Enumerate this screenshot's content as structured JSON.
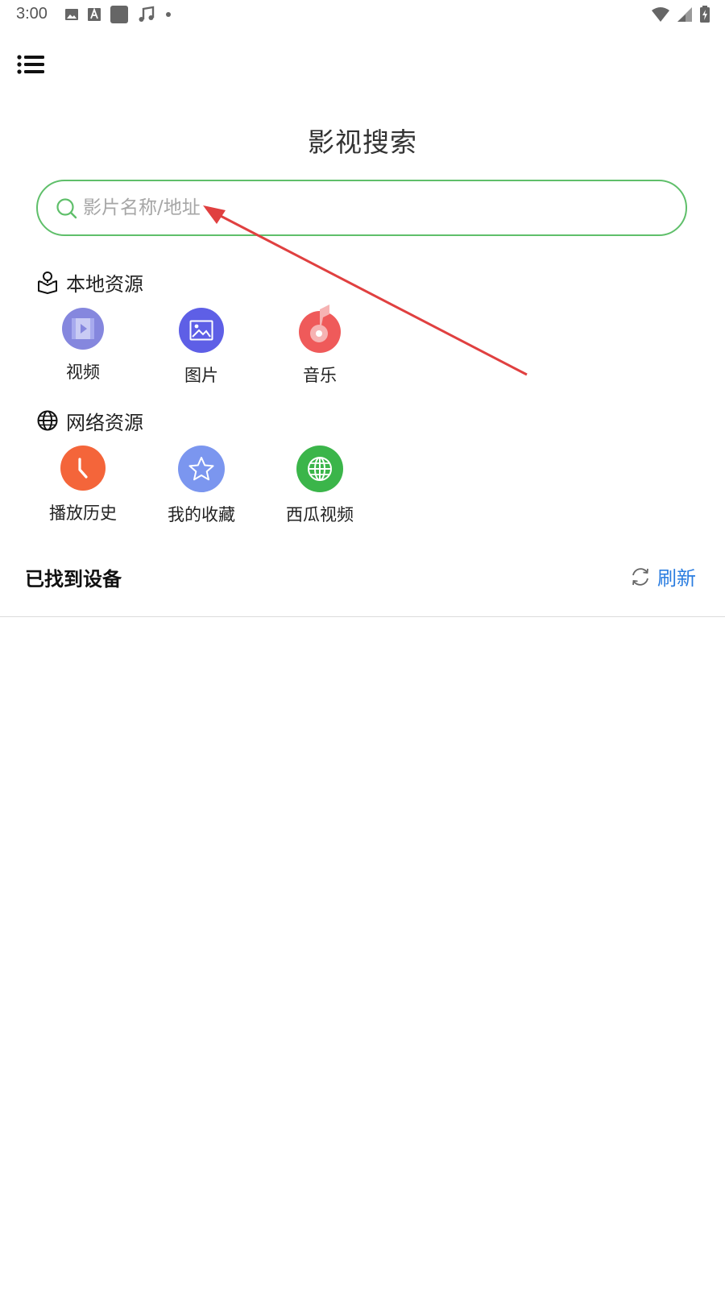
{
  "status_bar": {
    "time": "3:00",
    "left_icons": [
      "image-icon",
      "font-icon",
      "square-icon",
      "music-note-icon",
      "dot-icon"
    ],
    "right_icons": [
      "wifi-icon",
      "signal-icon",
      "battery-charging-icon"
    ]
  },
  "header": {
    "menu_icon": "list-menu-icon",
    "title": "影视搜索"
  },
  "search": {
    "placeholder": "影片名称/地址",
    "value": "",
    "accent_color": "#5fbf6a"
  },
  "local_section": {
    "title": "本地资源",
    "icon": "map-pin-book-icon",
    "items": [
      {
        "label": "视频",
        "icon": "video-icon",
        "color": "#7b7fe0"
      },
      {
        "label": "图片",
        "icon": "image-icon",
        "color": "#5b5fe8"
      },
      {
        "label": "音乐",
        "icon": "music-disc-icon",
        "color": "#ef5a5a"
      }
    ]
  },
  "network_section": {
    "title": "网络资源",
    "icon": "globe-icon",
    "items": [
      {
        "label": "播放历史",
        "icon": "clock-icon",
        "color": "#f4653a"
      },
      {
        "label": "我的收藏",
        "icon": "star-icon",
        "color": "#7b96ef"
      },
      {
        "label": "西瓜视频",
        "icon": "globe-icon",
        "color": "#3bb54a"
      }
    ]
  },
  "devices": {
    "title": "已找到设备",
    "refresh_label": "刷新",
    "refresh_color": "#2b7de0"
  },
  "annotation": {
    "color": "#e04040"
  }
}
